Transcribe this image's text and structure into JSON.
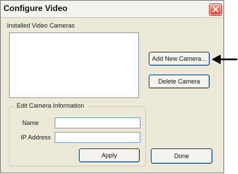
{
  "window": {
    "title": "Configure Video"
  },
  "cameras": {
    "label": "Installed Video Cameras",
    "items": []
  },
  "buttons": {
    "add_camera": "Add New Camera...",
    "delete_camera": "Delete Camera",
    "apply": "Apply",
    "done": "Done"
  },
  "edit_group": {
    "legend": "Edit Camera Information",
    "name_label": "Name",
    "name_value": "",
    "ip_label": "IP Address",
    "ip_value": ""
  },
  "icons": {
    "close": "close-icon",
    "pointer": "arrow-left-icon"
  }
}
